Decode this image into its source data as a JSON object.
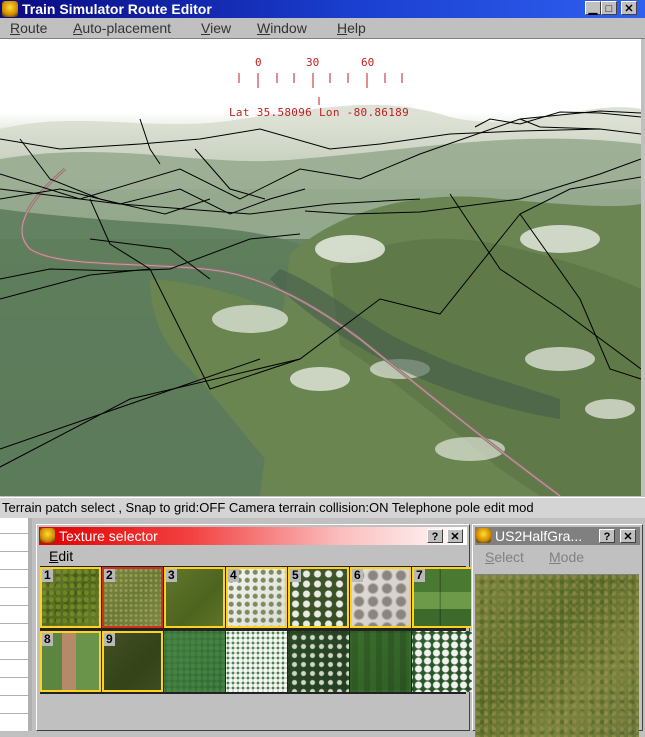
{
  "window": {
    "title": "Train Simulator Route Editor",
    "buttons": {
      "minimize": "▁",
      "maximize": "□",
      "close": "✕"
    }
  },
  "menu": [
    "Route",
    "Auto-placement",
    "View",
    "Window",
    "Help"
  ],
  "viewport": {
    "compass_labels": [
      "0",
      "30",
      "60"
    ],
    "latlon": "Lat 35.58096 Lon -80.86189"
  },
  "status": "Terrain patch select , Snap to grid:OFF Camera terrain collision:ON Telephone pole edit mod",
  "texture_selector": {
    "title": "Texture selector",
    "help_btn": "?",
    "close_btn": "✕",
    "menu": "Edit",
    "thumbnails": [
      {
        "num": "1",
        "texture": "grass",
        "state": "highlight"
      },
      {
        "num": "2",
        "texture": "grass2",
        "state": "selected"
      },
      {
        "num": "3",
        "texture": "grass3",
        "state": "highlight"
      },
      {
        "num": "4",
        "texture": "snow",
        "state": "highlight"
      },
      {
        "num": "5",
        "texture": "snowgrass",
        "state": "highlight"
      },
      {
        "num": "6",
        "texture": "snowrock",
        "state": "highlight"
      },
      {
        "num": "7",
        "texture": "fields",
        "state": "highlight"
      },
      {
        "num": "8",
        "texture": "fields2",
        "state": "highlight"
      },
      {
        "num": "9",
        "texture": "dark",
        "state": "highlight"
      },
      {
        "num": "",
        "texture": "green",
        "state": "plain"
      },
      {
        "num": "",
        "texture": "snowgreen",
        "state": "plain"
      },
      {
        "num": "",
        "texture": "mossy",
        "state": "plain"
      },
      {
        "num": "",
        "texture": "green2",
        "state": "plain"
      },
      {
        "num": "",
        "texture": "snowgreen2",
        "state": "plain"
      }
    ]
  },
  "preview_panel": {
    "title": "US2HalfGra...",
    "help_btn": "?",
    "close_btn": "✕",
    "menu": [
      "Select",
      "Mode"
    ]
  },
  "colors": {
    "title_active": "#0a0a80",
    "texture_title_start": "#e00000",
    "hud_red": "#c02020",
    "highlight_yellow": "#ffd21f",
    "selected_red": "#d03020"
  }
}
